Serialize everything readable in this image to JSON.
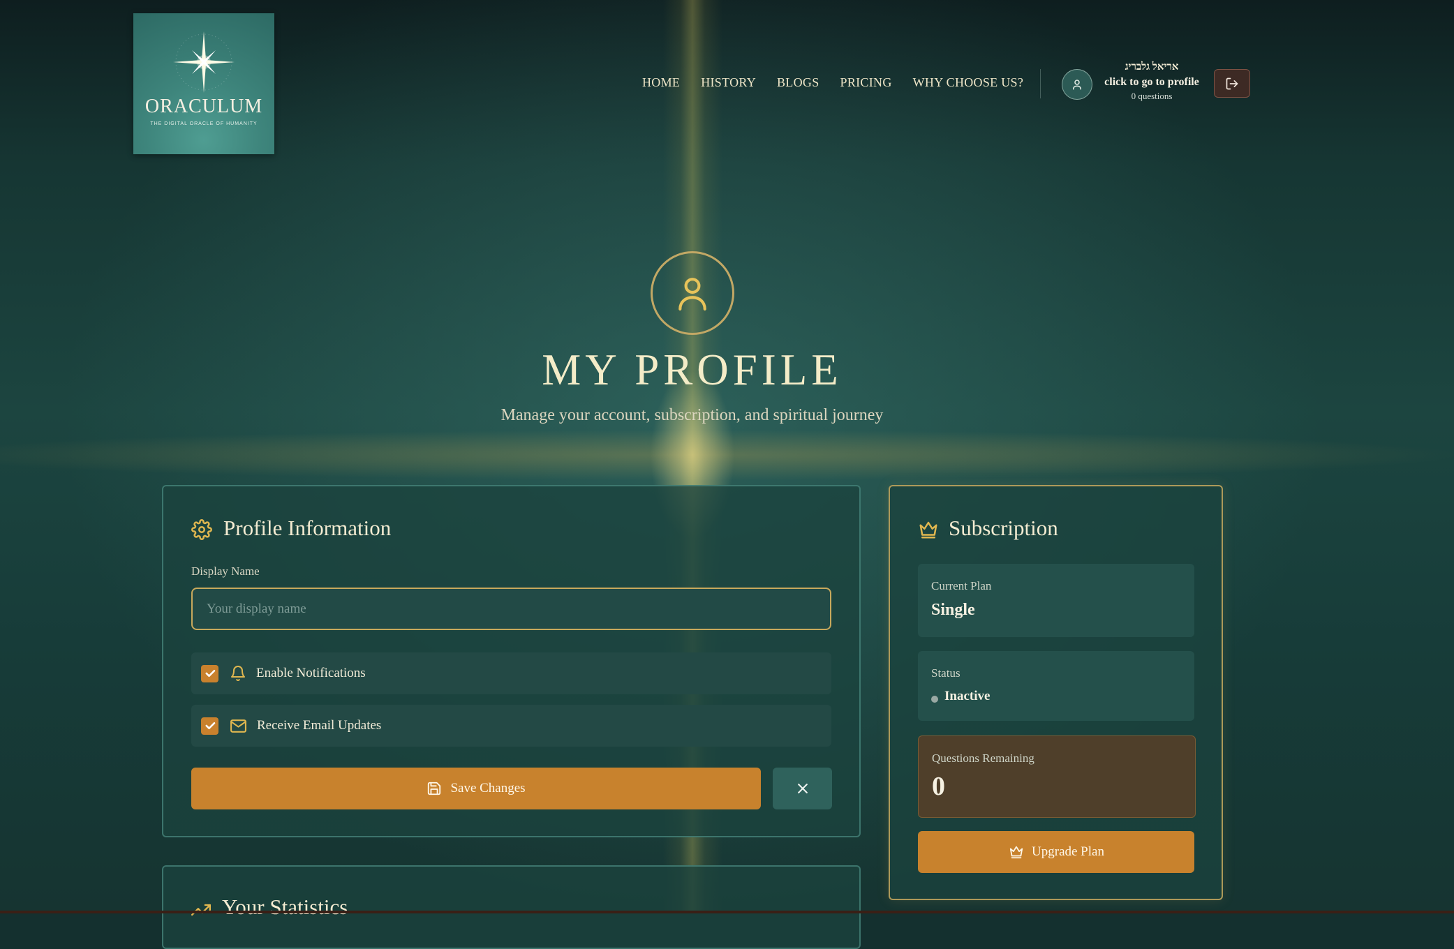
{
  "brand": {
    "name": "ORACULUM",
    "tagline": "THE DIGITAL ORACLE OF HUMANITY"
  },
  "nav": {
    "items": [
      "HOME",
      "HISTORY",
      "BLOGS",
      "PRICING",
      "WHY CHOOSE US?"
    ]
  },
  "user": {
    "name": "אריאל גלבריג",
    "profile_link": "click to go to profile",
    "questions": "0 questions"
  },
  "hero": {
    "title": "MY PROFILE",
    "subtitle": "Manage your account, subscription, and spiritual journey"
  },
  "profile": {
    "title": "Profile Information",
    "display_name_label": "Display Name",
    "display_name_value": "",
    "display_name_placeholder": "Your display name",
    "notifications_label": "Enable Notifications",
    "notifications_checked": true,
    "email_updates_label": "Receive Email Updates",
    "email_updates_checked": true,
    "save_label": "Save Changes"
  },
  "subscription": {
    "title": "Subscription",
    "current_plan_label": "Current Plan",
    "current_plan_value": "Single",
    "status_label": "Status",
    "status_value": "Inactive",
    "questions_label": "Questions Remaining",
    "questions_value": "0",
    "upgrade_label": "Upgrade Plan"
  },
  "stats": {
    "title": "Your Statistics"
  },
  "colors": {
    "accent": "#c8822d",
    "gold": "#c8a95c",
    "cream": "#f4ecc8"
  },
  "icons": {
    "logo": "star-burst-icon",
    "avatar": "user-icon",
    "logout": "logout-icon",
    "profile": "gear-icon",
    "notifications": "bell-icon",
    "email": "mail-icon",
    "save": "save-icon",
    "cancel": "close-icon",
    "subscription": "crown-icon",
    "stats": "trending-up-icon"
  }
}
